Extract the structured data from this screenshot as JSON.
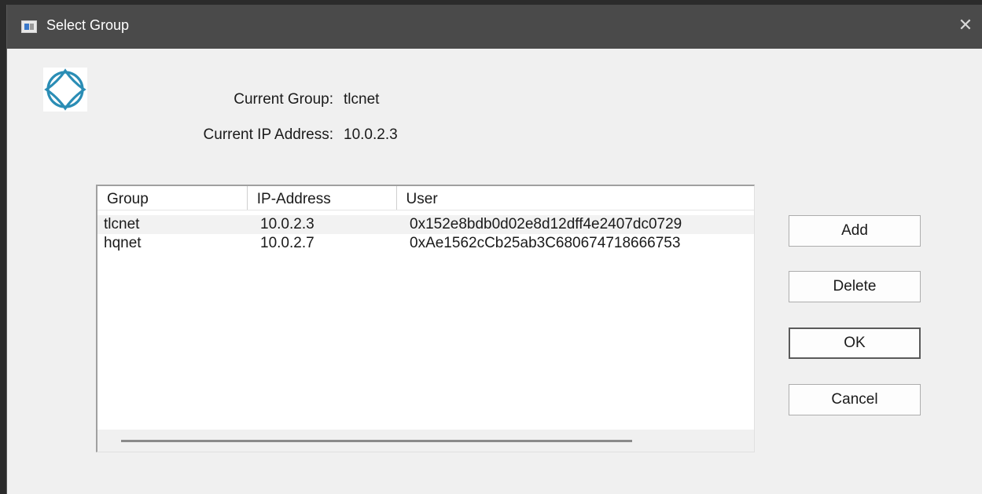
{
  "window": {
    "title": "Select Group"
  },
  "icons": {
    "app_icon": "window-icon",
    "close_icon": "close-icon",
    "logo_icon": "network-logo-icon",
    "close_glyph": "✕"
  },
  "info": {
    "current_group_label": "Current Group:",
    "current_group_value": "tlcnet",
    "current_ip_label": "Current IP Address:",
    "current_ip_value": "10.0.2.3"
  },
  "list": {
    "columns": [
      "Group",
      "IP-Address",
      "User"
    ],
    "rows": [
      [
        "tlcnet",
        "10.0.2.3",
        "0x152e8bdb0d02e8d12dff4e2407dc0729"
      ],
      [
        "hqnet",
        "10.0.2.7",
        "0xAe1562cCb25ab3C680674718666753"
      ]
    ]
  },
  "buttons": {
    "add": "Add",
    "delete": "Delete",
    "ok": "OK",
    "cancel": "Cancel"
  },
  "colors": {
    "titlebar": "#4a4a4a",
    "logo": "#2a8db5"
  }
}
